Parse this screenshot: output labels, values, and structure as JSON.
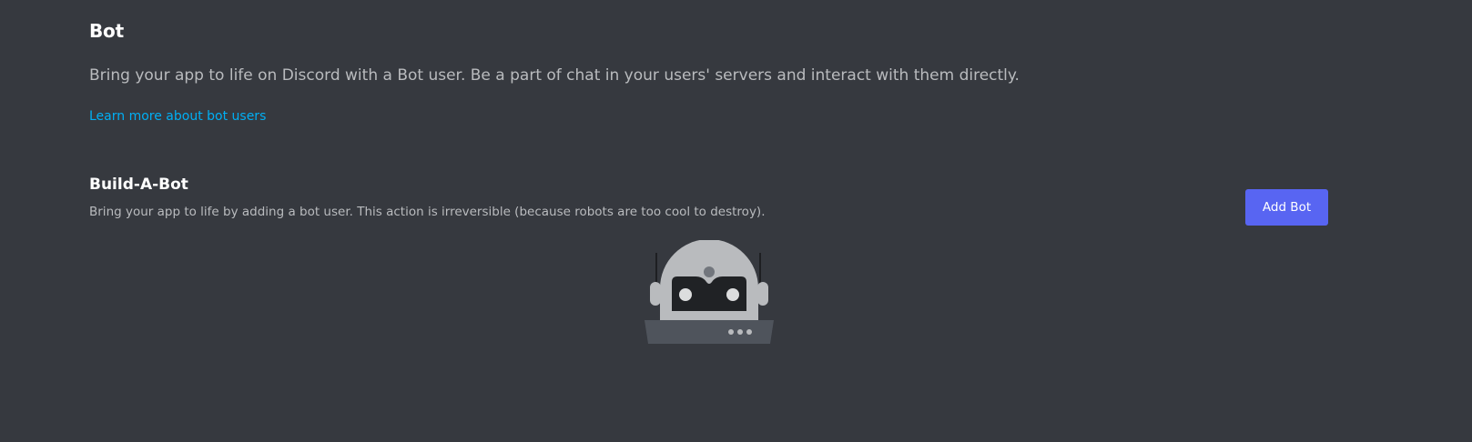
{
  "bot_section": {
    "title": "Bot",
    "description": "Bring your app to life on Discord with a Bot user. Be a part of chat in your users' servers and interact with them directly.",
    "learn_more_link": "Learn more about bot users"
  },
  "build_a_bot": {
    "title": "Build-A-Bot",
    "description": "Bring your app to life by adding a bot user. This action is irreversible (because robots are too cool to destroy).",
    "add_bot_button": "Add Bot"
  },
  "colors": {
    "background": "#36393f",
    "accent": "#5865f2",
    "link": "#00aff4"
  },
  "icons": {
    "robot_illustration": "robot-illustration"
  }
}
